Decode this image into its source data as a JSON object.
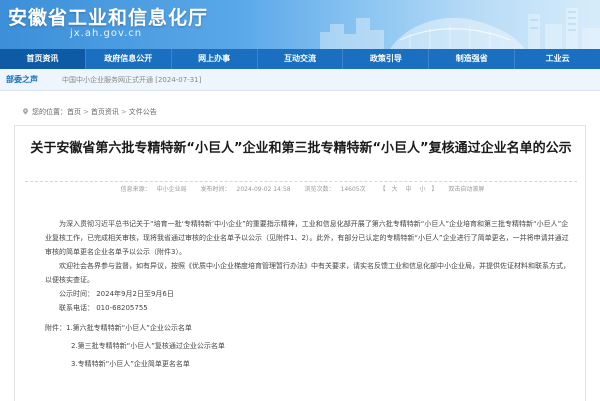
{
  "header": {
    "site_title": "安徽省工业和信息化厅",
    "site_domain": "jx.ah.gov.cn"
  },
  "nav": {
    "items": [
      "首页资讯",
      "政府信息公开",
      "网上办事",
      "互动交流",
      "政策引导",
      "制造强省",
      "工业云"
    ]
  },
  "strip": {
    "tag": "部委之声",
    "news": "中国中小企业服务网正式开通 [2024-07-31]"
  },
  "breadcrumb": {
    "prefix": "您的位置：",
    "items": [
      "首页",
      "首页资讯",
      "文件公告"
    ],
    "separator": ">"
  },
  "article": {
    "title": "关于安徽省第六批专精特新“小巨人”企业和第三批专精特新“小巨人”复核通过企业名单的公示",
    "meta": {
      "source_label": "信息来源：",
      "source": "中小企业局",
      "date_label": "发布时间：",
      "date": "2024-09-02 14:58",
      "views_label": "浏览次数：",
      "views": "14605次",
      "font_label": "【",
      "font_large": "大",
      "font_medium": "中",
      "font_small": "小",
      "font_end": "】",
      "auto_read": "双击自动滚屏"
    },
    "paragraph1": "为深入贯彻习近平总书记关于“培育一批‘专精特新’中小企业”的重要指示精神，工业和信息化部开展了第六批专精特新“小巨人”企业培育和第三批专精特新“小巨人”企业复核工作，已完成相关审核，现将我省通过审核的企业名单予以公示（见附件1、2）。此外，有部分已认定的专精特新“小巨人”企业进行了简单更名，一并将申请并通过审核的简单更名企业名单予以公示（附件3）。",
    "paragraph2": "欢迎社会各界参与监督，如有异议，按照《优质中小企业梯度培育管理暂行办法》中有关要求，请实名反馈工业和信息化部中小企业局，并提供佐证材料和联系方式，以便核实查证。",
    "publicity_time": "公示时间：  2024年9月2日至9月6日",
    "contact_phone": "联系电话：  010-68205755",
    "attachments_label": "附件：",
    "attachments": [
      "1.第六批专精特新“小巨人”企业公示名单",
      "2.第三批专精特新“小巨人”复核通过企业公示名单",
      "3.专精特新“小巨人”企业简单更名名单"
    ]
  },
  "colors": {
    "nav_bg": "#1a6fc1",
    "accent": "#1a6fc1"
  }
}
